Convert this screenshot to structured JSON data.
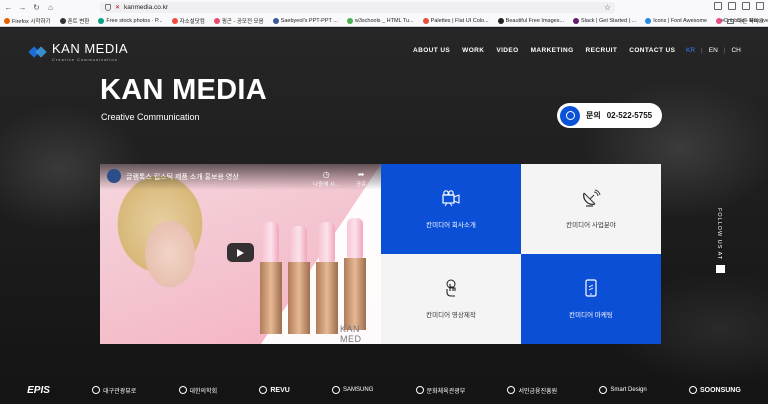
{
  "browser": {
    "url": "kanmedia.co.kr",
    "bookmarks": [
      {
        "label": "Firefox 시작하기",
        "color": "#e66000"
      },
      {
        "label": "폰트 변환",
        "color": "#333333"
      },
      {
        "label": "Free stock photos · P...",
        "color": "#05a081"
      },
      {
        "label": "자소설닷컴",
        "color": "#f24c3d"
      },
      {
        "label": "핑곤 - 공모전 모음",
        "color": "#e94b6b"
      },
      {
        "label": "Saebyeol's PPT-PPT ...",
        "color": "#3b5998"
      },
      {
        "label": "w3schools _ HTML Tu...",
        "color": "#4caf50"
      },
      {
        "label": "Palettes | Flat UI Colo...",
        "color": "#e74c3c"
      },
      {
        "label": "Beautiful Free Images...",
        "color": "#222222"
      },
      {
        "label": "Slack | Get Started | ...",
        "color": "#611f69"
      },
      {
        "label": "Icons | Font Awesome",
        "color": "#228ae6"
      },
      {
        "label": "Dribbble - Discover t...",
        "color": "#ea4c89"
      }
    ],
    "more_bookmarks": "다른 북마크"
  },
  "header": {
    "logo_name": "KAN MEDIA",
    "logo_sub": "Creative Communication",
    "menu": [
      "ABOUT US",
      "WORK",
      "VIDEO",
      "MARKETING",
      "RECRUIT",
      "CONTACT US"
    ],
    "languages": [
      "KR",
      "EN",
      "CH"
    ],
    "active_language": "KR"
  },
  "hero": {
    "title": "KAN MEDIA",
    "subtitle": "Creative Communication",
    "phone_label": "문의",
    "phone_number": "02-522-5755"
  },
  "video": {
    "title": "글램톡스 립스틱 제품 소개 홍보용 영상",
    "watch_later": "나중에 시...",
    "share": "공유",
    "brand": "KAN MED"
  },
  "tiles": [
    {
      "label": "칸미디어 회사소개",
      "icon": "video-camera-icon",
      "style": "blue"
    },
    {
      "label": "칸미디어 사업분야",
      "icon": "satellite-dish-icon",
      "style": "light"
    },
    {
      "label": "칸미디어 영상제작",
      "icon": "touch-icon",
      "style": "light"
    },
    {
      "label": "칸미디어 마케팅",
      "icon": "mobile-icon",
      "style": "blue"
    }
  ],
  "side_text": "FOLLOW US AT",
  "partners": [
    "EPIS",
    "대구관광뷰로",
    "대한의학회",
    "REVU",
    "SAMSUNG",
    "문화체육관광부",
    "서민금융진흥원",
    "Smart Design",
    "SOONSUNG"
  ],
  "colors": {
    "accent": "#0a4fd6",
    "active_lang": "#3a7bff"
  }
}
